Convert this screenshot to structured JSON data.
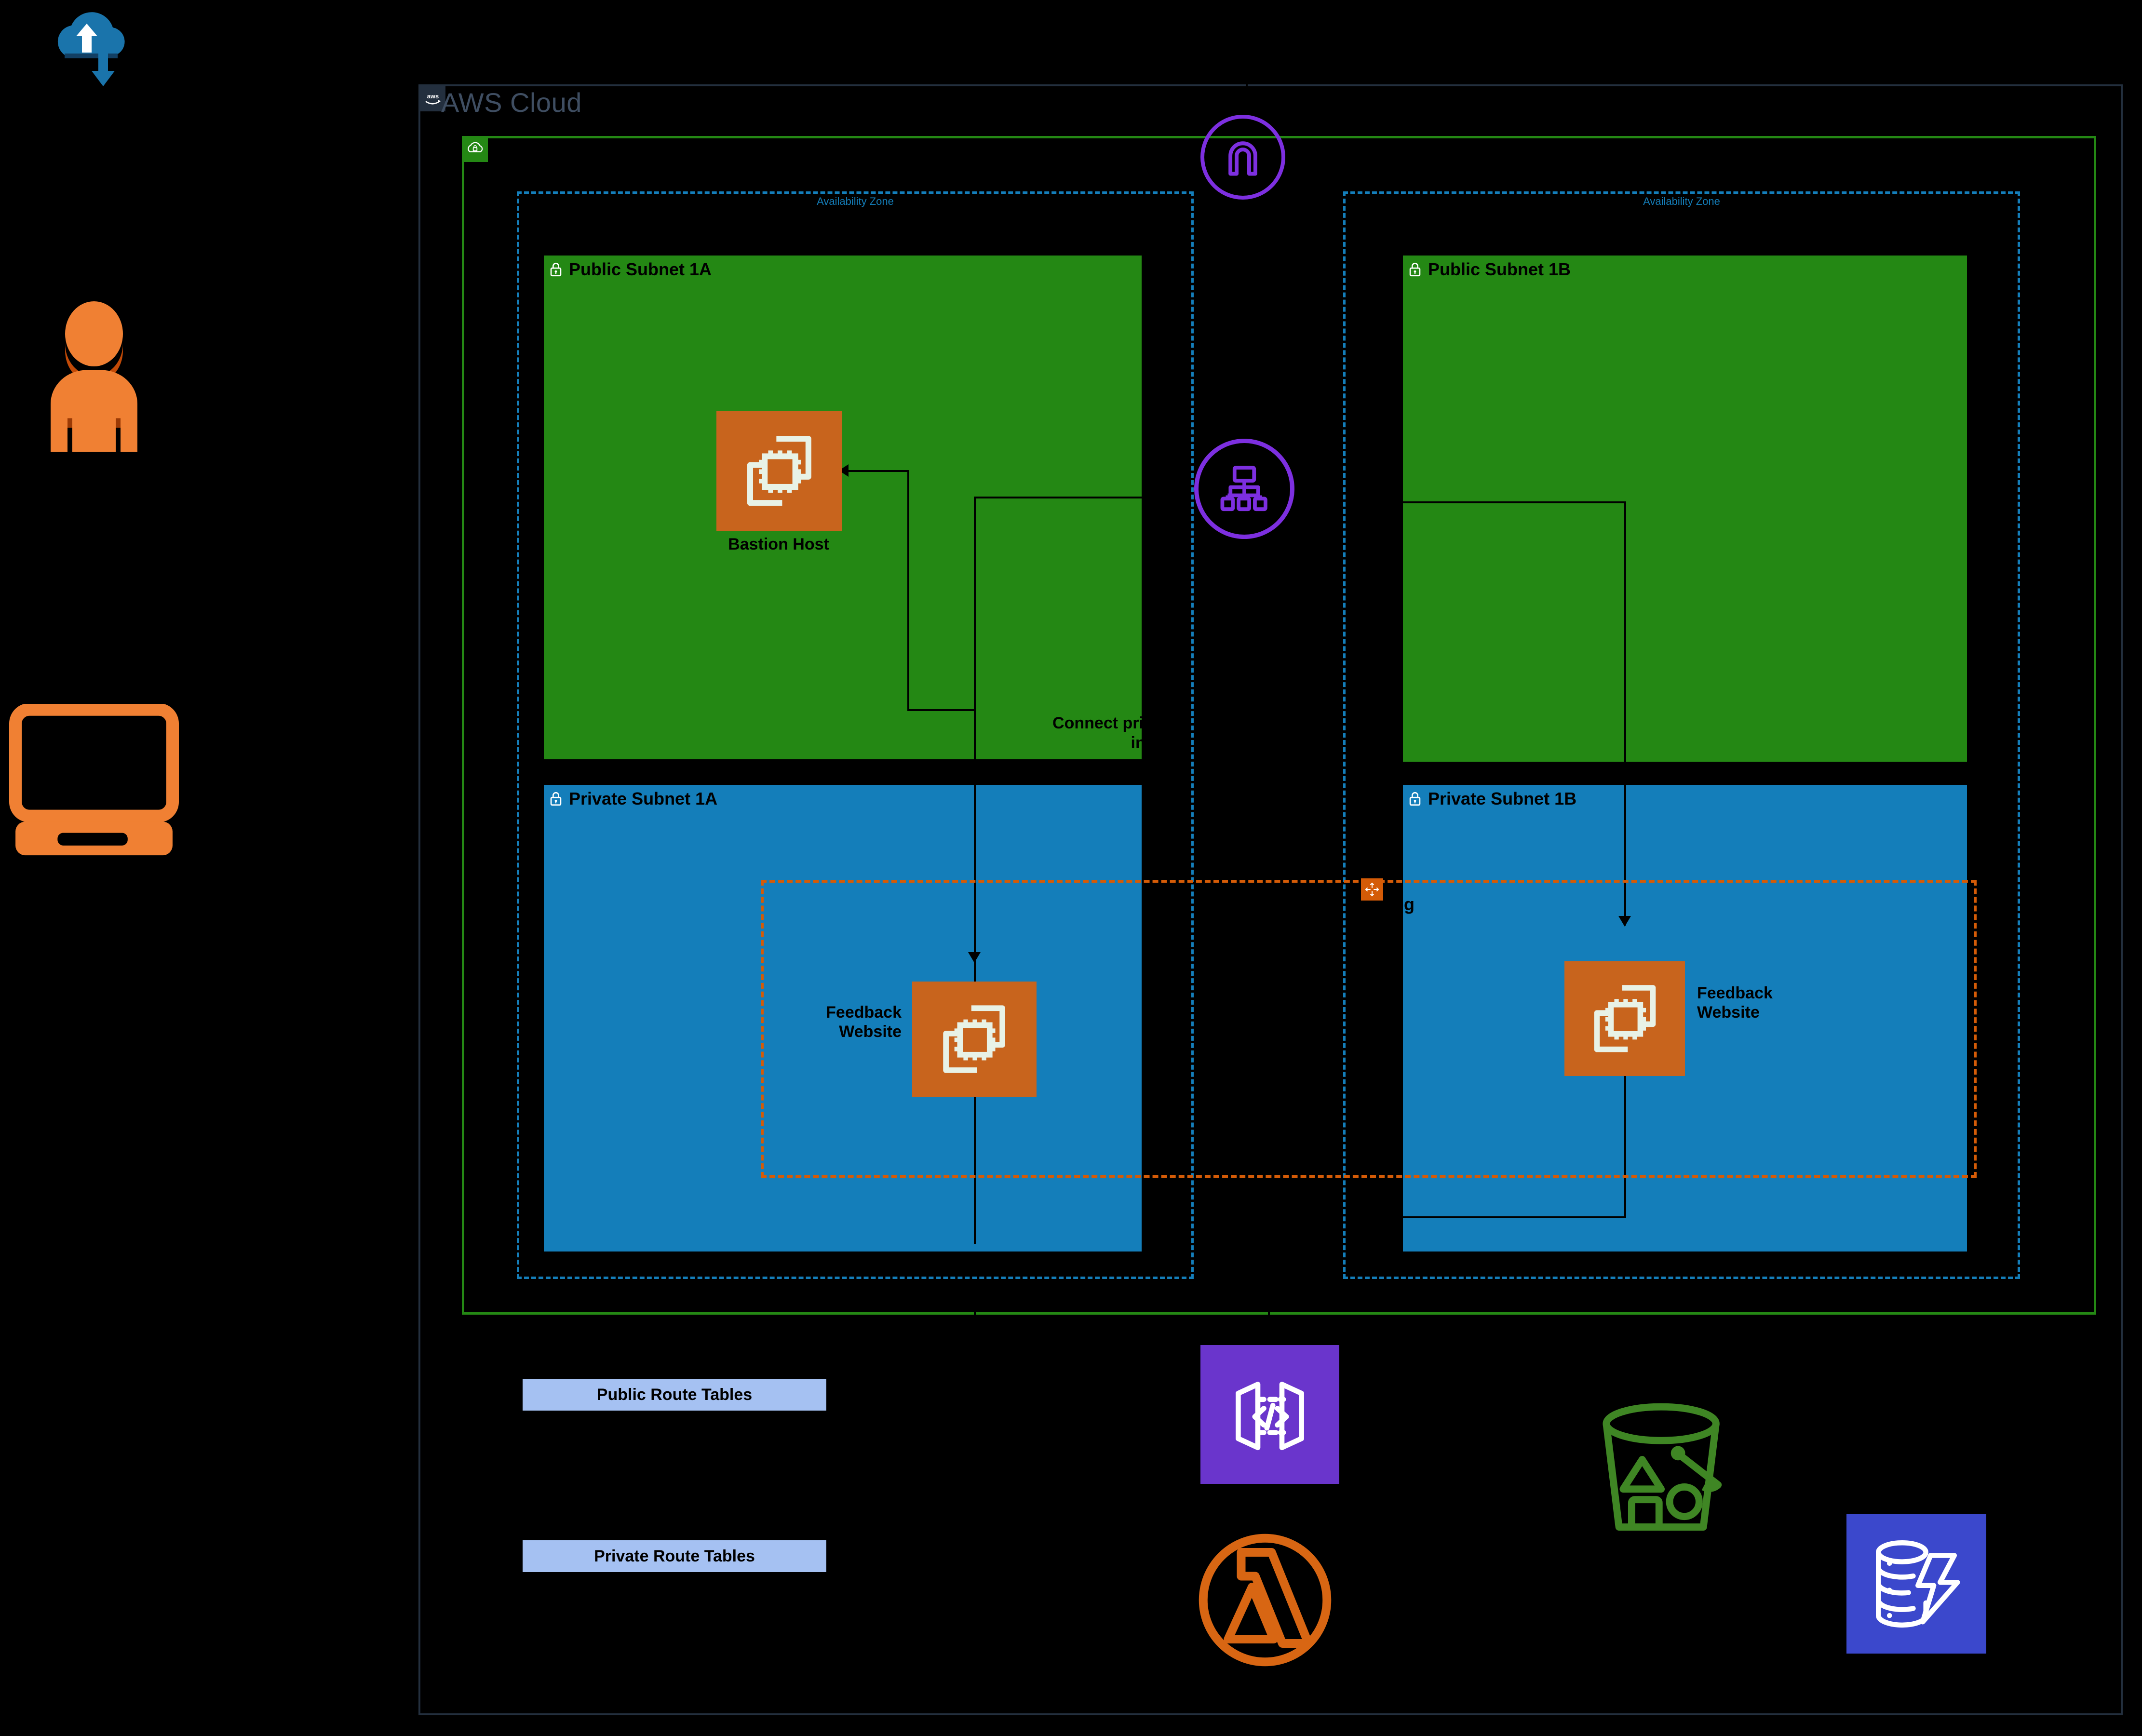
{
  "diagram": {
    "title": "AWS Cloud",
    "cloud_label": "AWS Cloud",
    "colors": {
      "aws_navy": "#232f3e",
      "vpc_green": "#248814",
      "az_blue": "#147eba",
      "ec2_orange": "#c8641d",
      "asg_orange": "#d45b07",
      "purple": "#7d2fe0",
      "apigw_purple": "#6a35cc",
      "s3_green": "#3f8624",
      "dynamodb_blue": "#3b48cc",
      "lambda_orange": "#d86613",
      "route_table_blue": "#a5c1f2"
    }
  },
  "availability_zones": [
    {
      "id": "az-a",
      "label": "Availability Zone"
    },
    {
      "id": "az-b",
      "label": "Availability Zone"
    }
  ],
  "subnets": [
    {
      "id": "public-a",
      "label": "Public Subnet 1A",
      "type": "public",
      "icon": "lock-icon"
    },
    {
      "id": "public-b",
      "label": "Public Subnet 1B",
      "type": "public",
      "icon": "lock-icon"
    },
    {
      "id": "private-a",
      "label": "Private Subnet 1A",
      "type": "private",
      "icon": "lock-icon"
    },
    {
      "id": "private-b",
      "label": "Private Subnet 1B",
      "type": "private",
      "icon": "lock-icon"
    }
  ],
  "instances": [
    {
      "id": "bastion",
      "label": "Bastion Host",
      "icon": "ec2-instance-icon"
    },
    {
      "id": "feedback-a",
      "label": "Feedback\nWebsite",
      "icon": "ec2-instance-icon"
    },
    {
      "id": "feedback-b",
      "label": "Feedback\nWebsite",
      "icon": "ec2-instance-icon"
    }
  ],
  "auto_scaling_group": {
    "label": "ing",
    "icon": "auto-scaling-icon"
  },
  "nat_note": {
    "line1": "Connect private",
    "line2": "intern"
  },
  "network_icons": [
    {
      "id": "internet-gateway",
      "icon": "internet-gateway-icon"
    },
    {
      "id": "load-balancer",
      "icon": "load-balancer-icon"
    }
  ],
  "route_tables": [
    {
      "id": "public-route-tables",
      "label": "Public Route Tables"
    },
    {
      "id": "private-route-tables",
      "label": "Private Route Tables"
    }
  ],
  "services": [
    {
      "id": "api-gateway",
      "icon": "api-gateway-icon"
    },
    {
      "id": "lambda",
      "icon": "lambda-icon"
    },
    {
      "id": "s3",
      "icon": "s3-bucket-icon"
    },
    {
      "id": "dynamodb",
      "icon": "dynamodb-icon"
    }
  ],
  "actors": [
    {
      "id": "internet",
      "icon": "cloud-sync-icon"
    },
    {
      "id": "user",
      "icon": "user-icon"
    },
    {
      "id": "computer",
      "icon": "desktop-computer-icon"
    }
  ]
}
